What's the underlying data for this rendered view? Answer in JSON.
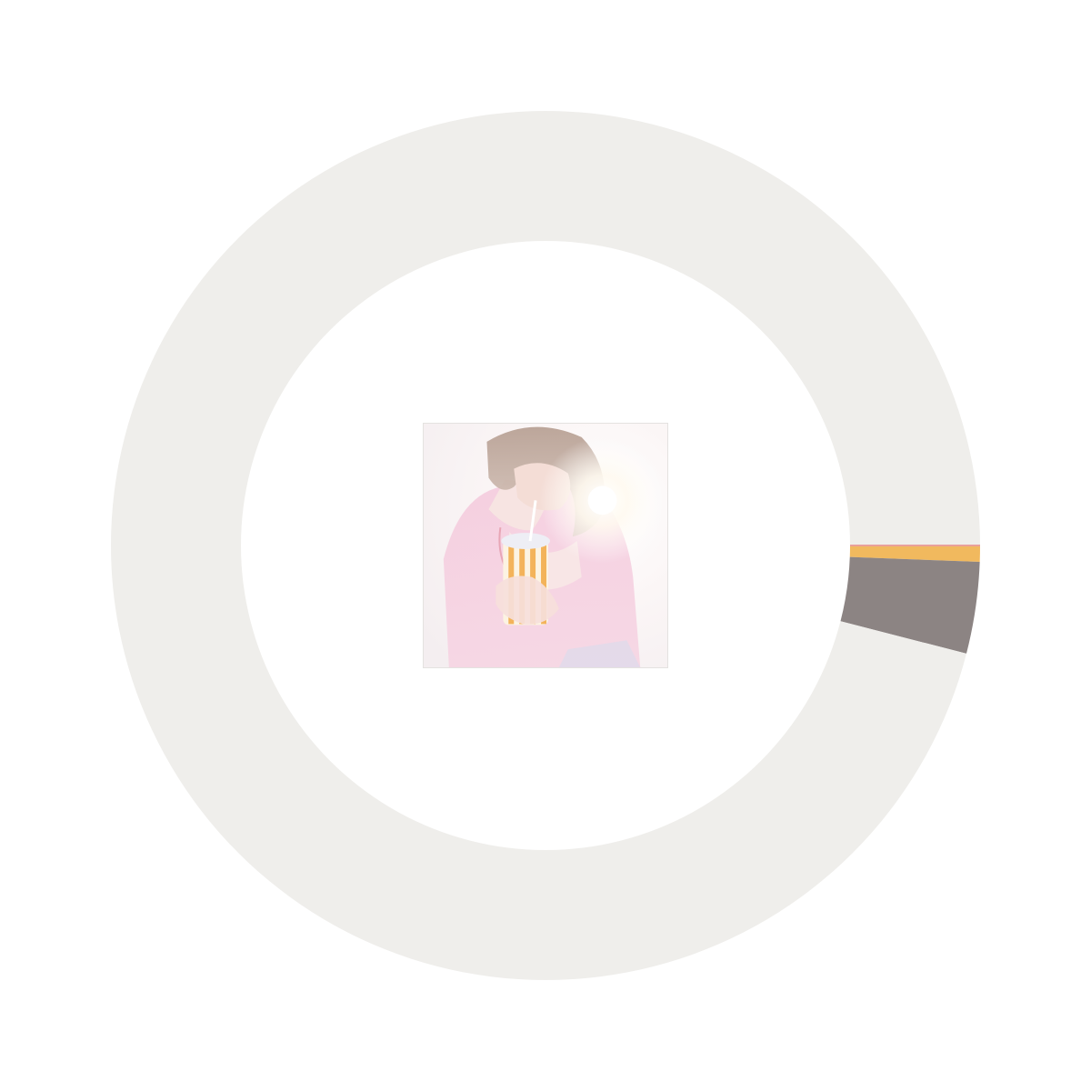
{
  "chart_data": {
    "type": "pie",
    "variant": "donut",
    "start_angle": "3 o'clock",
    "direction": "clockwise",
    "legend": "none",
    "slices": [
      {
        "value": 0.006,
        "color": "#f1b95e"
      },
      {
        "value": 0.034,
        "color": "#8c8483"
      },
      {
        "value": 0.96,
        "color": "#efeeeb"
      }
    ]
  },
  "center_image": {
    "icon": "album-cover-photo"
  },
  "colors": {
    "background": "#ffffff",
    "ring": "#efeeeb",
    "accent": "#f1b95e",
    "accent_edge": "#e9a09a",
    "secondary": "#8c8483"
  }
}
